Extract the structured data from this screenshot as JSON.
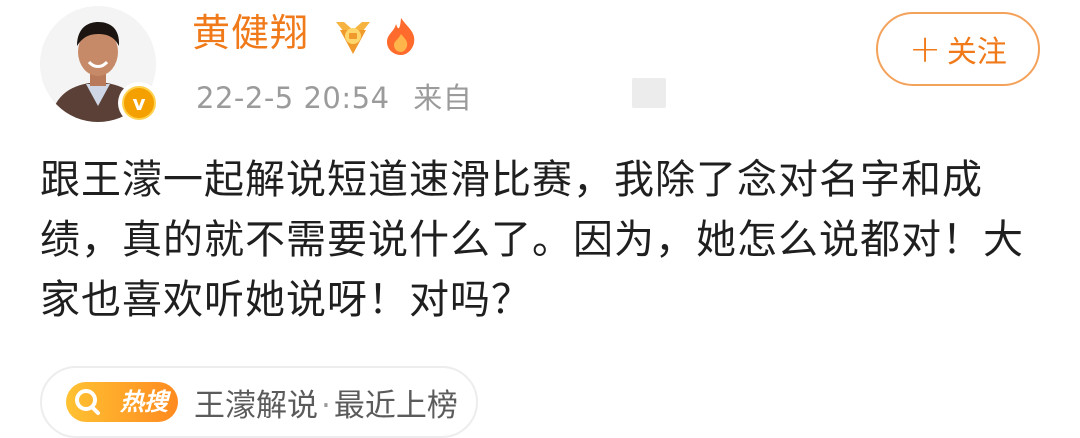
{
  "user": {
    "name": "黄健翔",
    "verified_mark": "v",
    "badges": [
      "vip-medal-icon",
      "fire-level-icon"
    ]
  },
  "meta": {
    "timestamp": "22-2-5 20:54",
    "source_prefix": "来自"
  },
  "follow_button": {
    "plus": "+",
    "label": "关注"
  },
  "post": {
    "text": "跟王濛一起解说短道速滑比赛，我除了念对名字和成绩，真的就不需要说什么了。因为，她怎么说都对！大家也喜欢听她说呀！对吗？"
  },
  "hot_search": {
    "icon_label": "热搜",
    "topic": "王濛解说",
    "separator": "·",
    "status": "最近上榜"
  },
  "colors": {
    "accent": "#f07a1a",
    "button_border": "#f4a25a",
    "meta_gray": "#9b9b9b",
    "hot_gradient_start": "#ffc233",
    "hot_gradient_end": "#ff8a1f"
  }
}
